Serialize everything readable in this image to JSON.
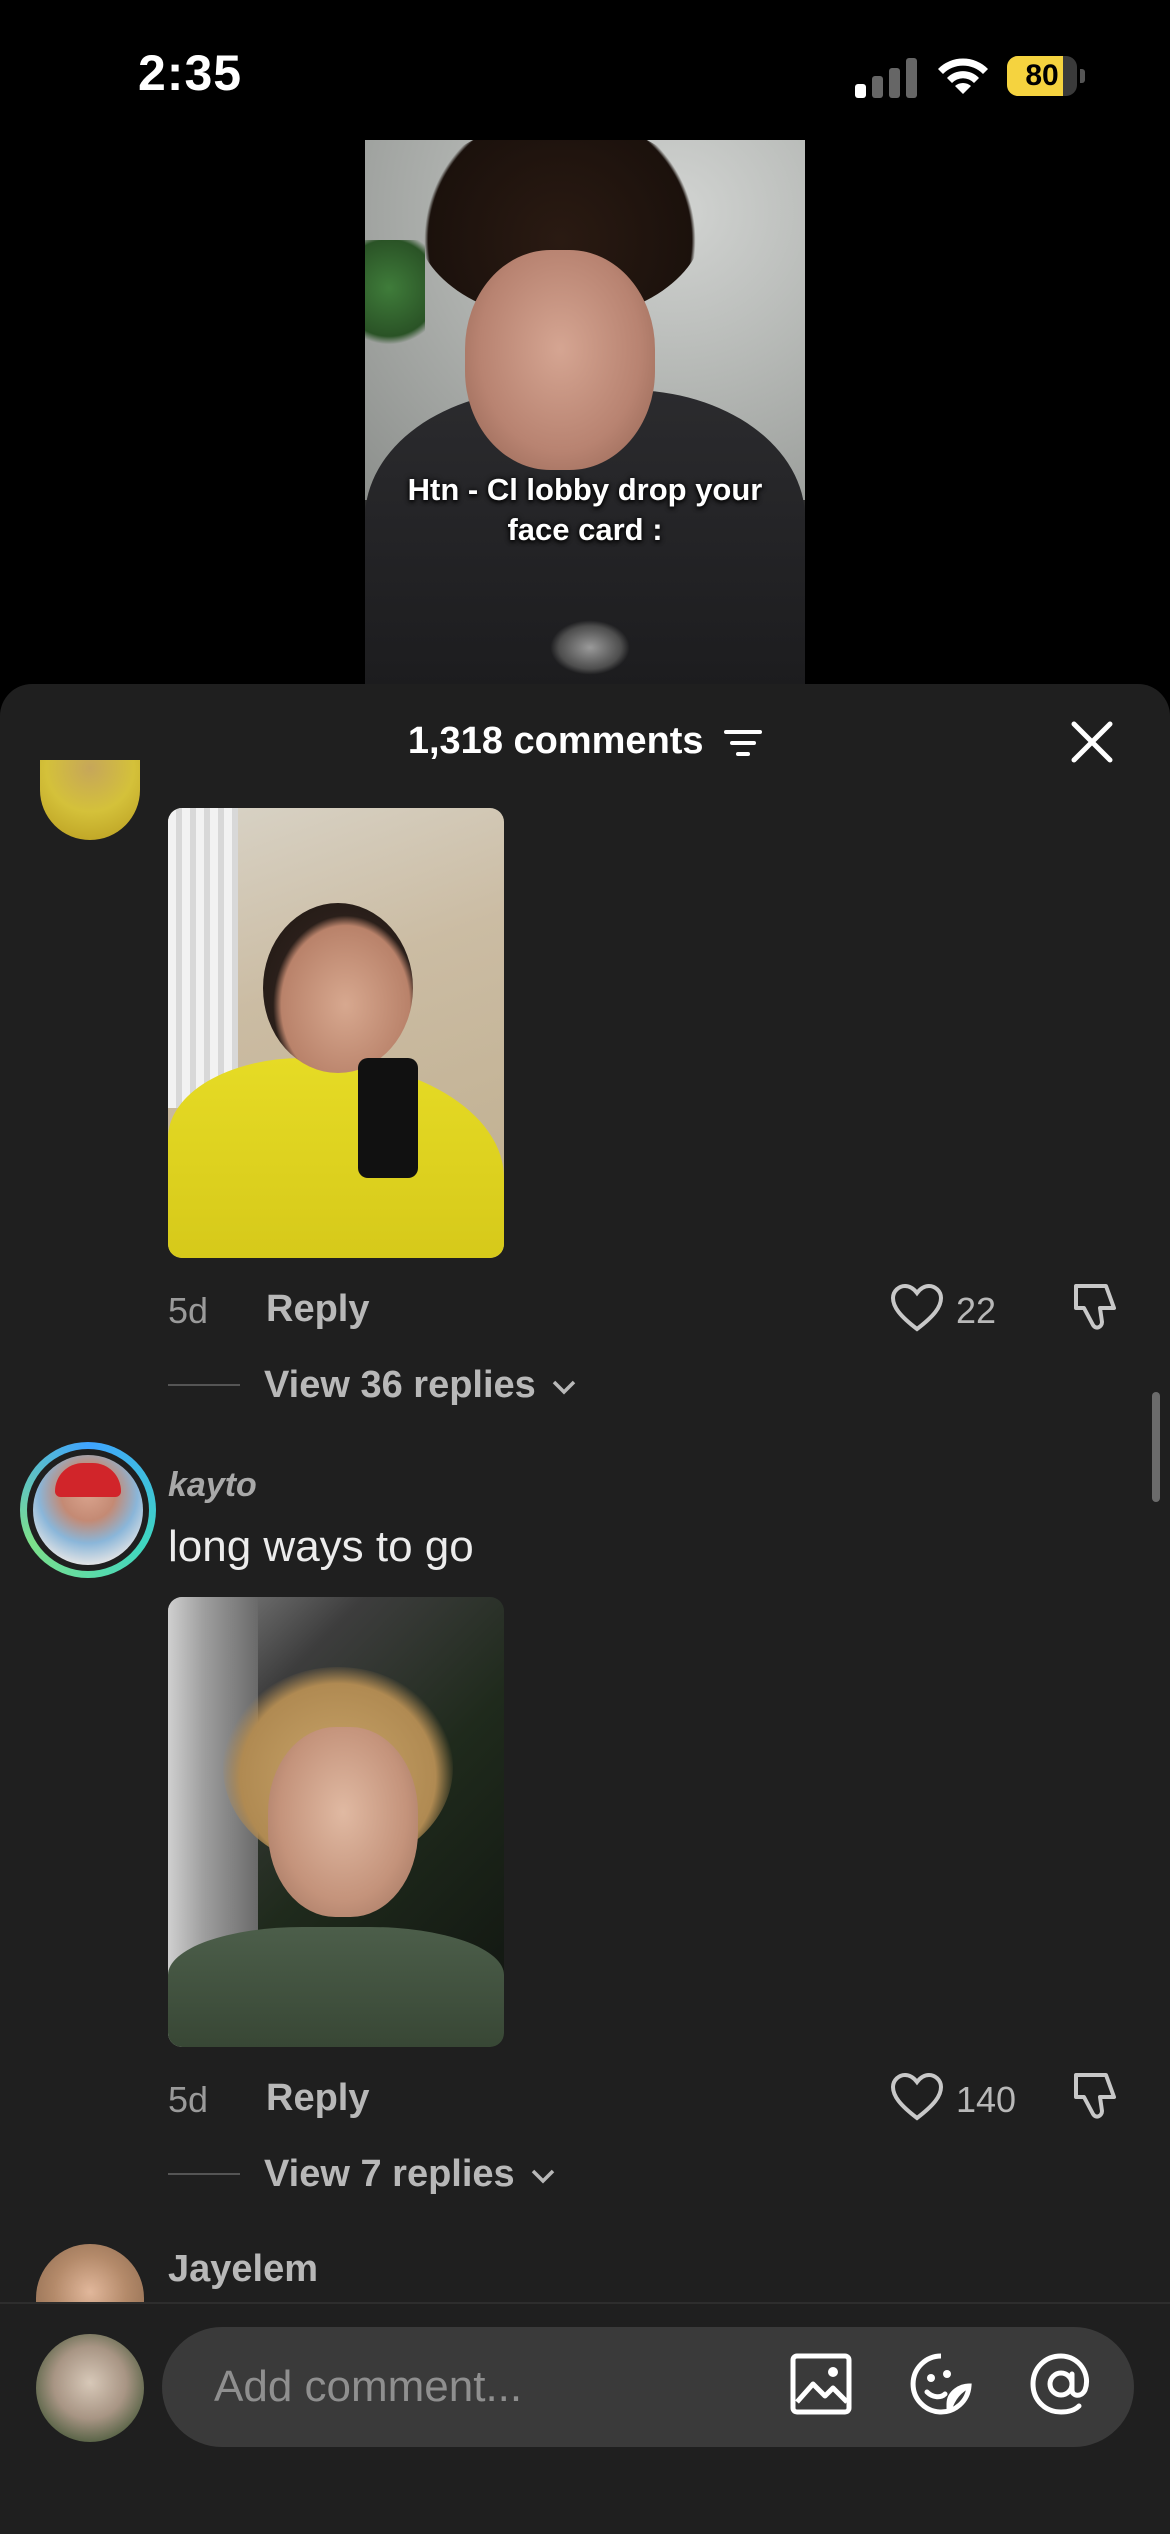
{
  "status_bar": {
    "time": "2:35",
    "battery_level": "80",
    "battery_fraction": 0.8,
    "signal_bars_active": 1,
    "battery_color": "#f5d33f"
  },
  "video": {
    "caption": "Htn - Cl lobby drop your face card :"
  },
  "comments_header": {
    "count_label": "1,318 comments",
    "filter_icon": "filter-icon",
    "close_icon": "close-icon"
  },
  "comments": [
    {
      "username": "",
      "text": "",
      "has_photo": true,
      "age": "5d",
      "reply_label": "Reply",
      "likes": "22",
      "view_replies_label": "View 36 replies"
    },
    {
      "username": "kayto",
      "text": "long ways to go",
      "has_photo": true,
      "age": "5d",
      "reply_label": "Reply",
      "likes": "140",
      "view_replies_label": "View 7 replies"
    },
    {
      "username": "Jayelem"
    }
  ],
  "composer": {
    "placeholder": "Add comment...",
    "icons": [
      "image-icon",
      "sticker-icon",
      "mention-icon"
    ]
  },
  "colors": {
    "sheet_background": "#1f1f1f",
    "input_background": "#3a3a3a",
    "story_ring": "#3fa3ff"
  }
}
